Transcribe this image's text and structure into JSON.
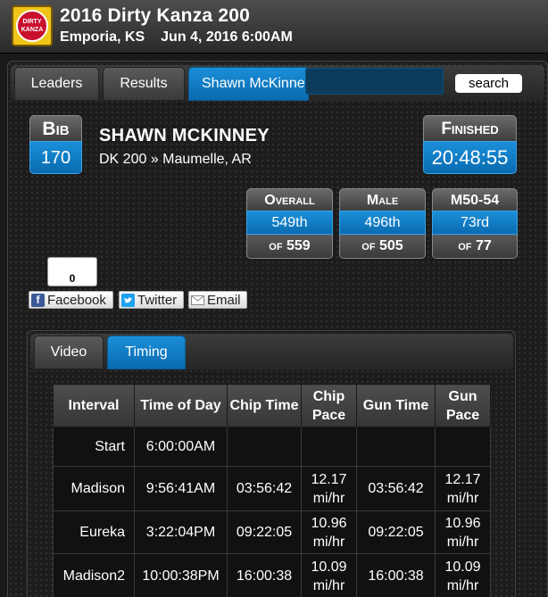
{
  "event": {
    "title": "2016 Dirty Kanza 200",
    "location": "Emporia, KS",
    "datetime": "Jun 4, 2016 6:00AM",
    "logo_text": "DIRTY KANZA"
  },
  "tabs": {
    "leaders": "Leaders",
    "results": "Results",
    "athlete": "Shawn McKinney"
  },
  "search": {
    "value": "",
    "button": "search"
  },
  "athlete": {
    "bib_label": "Bib",
    "bib": "170",
    "name": "SHAWN MCKINNEY",
    "subtitle": "DK 200 » Maumelle, AR",
    "status_label": "Finished",
    "finish_time": "20:48:55"
  },
  "rankings": {
    "overall": {
      "label": "Overall",
      "place": "549th",
      "of": "of 559"
    },
    "gender": {
      "label": "Male",
      "place": "496th",
      "of": "of 505"
    },
    "division": {
      "label": "M50-54",
      "place": "73rd",
      "of": "of 77"
    }
  },
  "social": {
    "like_count": "0",
    "facebook": "Facebook",
    "twitter": "Twitter",
    "email": "Email"
  },
  "subtabs": {
    "video": "Video",
    "timing": "Timing"
  },
  "timing": {
    "headers": [
      "Interval",
      "Time of Day",
      "Chip Time",
      "Chip Pace",
      "Gun Time",
      "Gun Pace"
    ],
    "rows": [
      {
        "interval": "Start",
        "tod": "6:00:00AM",
        "chip": "",
        "chip_pace": "",
        "gun": "",
        "gun_pace": ""
      },
      {
        "interval": "Madison",
        "tod": "9:56:41AM",
        "chip": "03:56:42",
        "chip_pace": "12.17 mi/hr",
        "gun": "03:56:42",
        "gun_pace": "12.17 mi/hr"
      },
      {
        "interval": "Eureka",
        "tod": "3:22:04PM",
        "chip": "09:22:05",
        "chip_pace": "10.96 mi/hr",
        "gun": "09:22:05",
        "gun_pace": "10.96 mi/hr"
      },
      {
        "interval": "Madison2",
        "tod": "10:00:38PM",
        "chip": "16:00:38",
        "chip_pace": "10.09 mi/hr",
        "gun": "16:00:38",
        "gun_pace": "10.09 mi/hr"
      }
    ]
  },
  "colors": {
    "accent": "#0a6bb0",
    "background": "#1a1a1a",
    "logo_yellow": "#f0c419",
    "logo_red": "#c8102e"
  }
}
